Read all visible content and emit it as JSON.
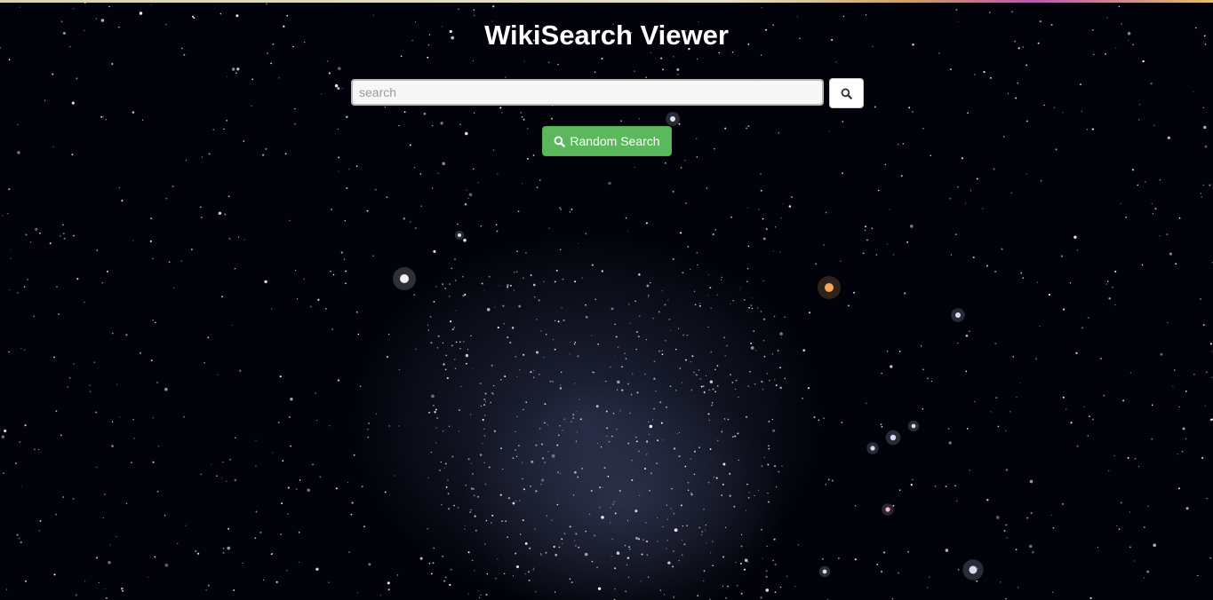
{
  "header": {
    "title": "WikiSearch Viewer"
  },
  "search": {
    "placeholder": "search",
    "value": "",
    "button_icon": "search-icon"
  },
  "random": {
    "label": "Random Search",
    "icon": "search-icon"
  },
  "colors": {
    "background": "#02030a",
    "title": "#ffffff",
    "random_button": "#5cb85c",
    "search_button": "#ffffff"
  }
}
